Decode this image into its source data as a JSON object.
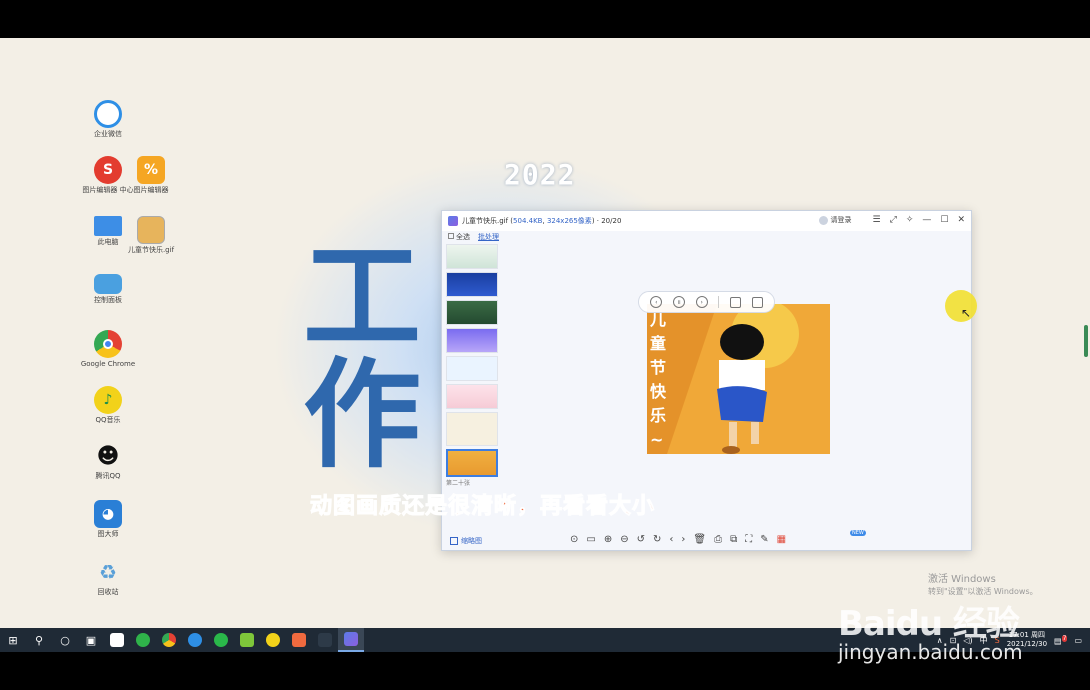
{
  "desktop": {
    "year": "2022",
    "big_text": [
      "工",
      "作"
    ],
    "icons": [
      {
        "label": "企业微信",
        "icon": "wecom-icon",
        "color": "#2e8fe6"
      },
      {
        "label": "图片编辑器 中心",
        "icon": "app-red-icon",
        "color": "#e33c2f"
      },
      {
        "label": "图片编辑器",
        "icon": "app-orange-icon",
        "color": "#f5a623"
      },
      {
        "label": "此电脑",
        "icon": "computer-icon",
        "color": "#3d8ee6"
      },
      {
        "label": "儿童节快乐.gif",
        "icon": "gif-file-icon",
        "color": "#e7b45c"
      },
      {
        "label": "控制面板",
        "icon": "control-panel-icon",
        "color": "#4aa0e0"
      },
      {
        "label": "Google Chrome",
        "icon": "chrome-icon",
        "color": "#e44134"
      },
      {
        "label": "QQ音乐",
        "icon": "qqmusic-icon",
        "color": "#f2d21a"
      },
      {
        "label": "腾讯QQ",
        "icon": "qq-icon",
        "color": "#222222"
      },
      {
        "label": "图大师",
        "icon": "doraemon-icon",
        "color": "#2a7fd6"
      },
      {
        "label": "回收站",
        "icon": "recycle-bin-icon",
        "color": "#5aa0d8"
      }
    ]
  },
  "viewer": {
    "filename": "儿童节快乐.gif",
    "filesize": "504.4KB",
    "dimensions": "324x265像素",
    "index": "20/20",
    "login_label": "请登录",
    "select_all": "全选",
    "batch_label": "批处理",
    "thumbs_toggle_label": "缩略图",
    "image_text": [
      "儿",
      "童",
      "节",
      "快",
      "乐",
      "~"
    ],
    "thumbnail_caption": "第二十张"
  },
  "subtitle": "动图画质还是很清晰，再看看大小",
  "activation": {
    "line1": "激活 Windows",
    "line2": "转到\"设置\"以激活 Windows。"
  },
  "taskbar": {
    "clock_time": "17:01 周四",
    "clock_date": "2021/12/30",
    "ime_label": "中",
    "notification_count": "7"
  },
  "watermark": {
    "brand": "Baidu 经验",
    "url": "jingyan.baidu.com"
  }
}
